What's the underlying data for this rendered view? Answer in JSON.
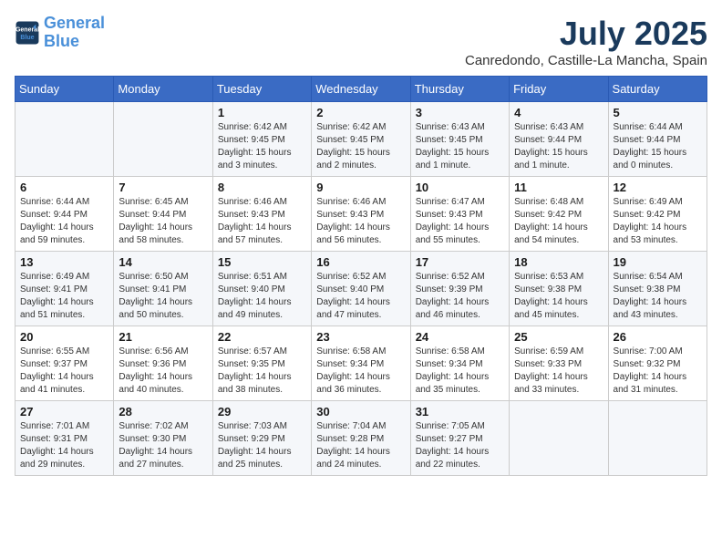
{
  "header": {
    "logo_line1": "General",
    "logo_line2": "Blue",
    "month": "July 2025",
    "location": "Canredondo, Castille-La Mancha, Spain"
  },
  "weekdays": [
    "Sunday",
    "Monday",
    "Tuesday",
    "Wednesday",
    "Thursday",
    "Friday",
    "Saturday"
  ],
  "weeks": [
    [
      {
        "day": "",
        "detail": ""
      },
      {
        "day": "",
        "detail": ""
      },
      {
        "day": "1",
        "detail": "Sunrise: 6:42 AM\nSunset: 9:45 PM\nDaylight: 15 hours\nand 3 minutes."
      },
      {
        "day": "2",
        "detail": "Sunrise: 6:42 AM\nSunset: 9:45 PM\nDaylight: 15 hours\nand 2 minutes."
      },
      {
        "day": "3",
        "detail": "Sunrise: 6:43 AM\nSunset: 9:45 PM\nDaylight: 15 hours\nand 1 minute."
      },
      {
        "day": "4",
        "detail": "Sunrise: 6:43 AM\nSunset: 9:44 PM\nDaylight: 15 hours\nand 1 minute."
      },
      {
        "day": "5",
        "detail": "Sunrise: 6:44 AM\nSunset: 9:44 PM\nDaylight: 15 hours\nand 0 minutes."
      }
    ],
    [
      {
        "day": "6",
        "detail": "Sunrise: 6:44 AM\nSunset: 9:44 PM\nDaylight: 14 hours\nand 59 minutes."
      },
      {
        "day": "7",
        "detail": "Sunrise: 6:45 AM\nSunset: 9:44 PM\nDaylight: 14 hours\nand 58 minutes."
      },
      {
        "day": "8",
        "detail": "Sunrise: 6:46 AM\nSunset: 9:43 PM\nDaylight: 14 hours\nand 57 minutes."
      },
      {
        "day": "9",
        "detail": "Sunrise: 6:46 AM\nSunset: 9:43 PM\nDaylight: 14 hours\nand 56 minutes."
      },
      {
        "day": "10",
        "detail": "Sunrise: 6:47 AM\nSunset: 9:43 PM\nDaylight: 14 hours\nand 55 minutes."
      },
      {
        "day": "11",
        "detail": "Sunrise: 6:48 AM\nSunset: 9:42 PM\nDaylight: 14 hours\nand 54 minutes."
      },
      {
        "day": "12",
        "detail": "Sunrise: 6:49 AM\nSunset: 9:42 PM\nDaylight: 14 hours\nand 53 minutes."
      }
    ],
    [
      {
        "day": "13",
        "detail": "Sunrise: 6:49 AM\nSunset: 9:41 PM\nDaylight: 14 hours\nand 51 minutes."
      },
      {
        "day": "14",
        "detail": "Sunrise: 6:50 AM\nSunset: 9:41 PM\nDaylight: 14 hours\nand 50 minutes."
      },
      {
        "day": "15",
        "detail": "Sunrise: 6:51 AM\nSunset: 9:40 PM\nDaylight: 14 hours\nand 49 minutes."
      },
      {
        "day": "16",
        "detail": "Sunrise: 6:52 AM\nSunset: 9:40 PM\nDaylight: 14 hours\nand 47 minutes."
      },
      {
        "day": "17",
        "detail": "Sunrise: 6:52 AM\nSunset: 9:39 PM\nDaylight: 14 hours\nand 46 minutes."
      },
      {
        "day": "18",
        "detail": "Sunrise: 6:53 AM\nSunset: 9:38 PM\nDaylight: 14 hours\nand 45 minutes."
      },
      {
        "day": "19",
        "detail": "Sunrise: 6:54 AM\nSunset: 9:38 PM\nDaylight: 14 hours\nand 43 minutes."
      }
    ],
    [
      {
        "day": "20",
        "detail": "Sunrise: 6:55 AM\nSunset: 9:37 PM\nDaylight: 14 hours\nand 41 minutes."
      },
      {
        "day": "21",
        "detail": "Sunrise: 6:56 AM\nSunset: 9:36 PM\nDaylight: 14 hours\nand 40 minutes."
      },
      {
        "day": "22",
        "detail": "Sunrise: 6:57 AM\nSunset: 9:35 PM\nDaylight: 14 hours\nand 38 minutes."
      },
      {
        "day": "23",
        "detail": "Sunrise: 6:58 AM\nSunset: 9:34 PM\nDaylight: 14 hours\nand 36 minutes."
      },
      {
        "day": "24",
        "detail": "Sunrise: 6:58 AM\nSunset: 9:34 PM\nDaylight: 14 hours\nand 35 minutes."
      },
      {
        "day": "25",
        "detail": "Sunrise: 6:59 AM\nSunset: 9:33 PM\nDaylight: 14 hours\nand 33 minutes."
      },
      {
        "day": "26",
        "detail": "Sunrise: 7:00 AM\nSunset: 9:32 PM\nDaylight: 14 hours\nand 31 minutes."
      }
    ],
    [
      {
        "day": "27",
        "detail": "Sunrise: 7:01 AM\nSunset: 9:31 PM\nDaylight: 14 hours\nand 29 minutes."
      },
      {
        "day": "28",
        "detail": "Sunrise: 7:02 AM\nSunset: 9:30 PM\nDaylight: 14 hours\nand 27 minutes."
      },
      {
        "day": "29",
        "detail": "Sunrise: 7:03 AM\nSunset: 9:29 PM\nDaylight: 14 hours\nand 25 minutes."
      },
      {
        "day": "30",
        "detail": "Sunrise: 7:04 AM\nSunset: 9:28 PM\nDaylight: 14 hours\nand 24 minutes."
      },
      {
        "day": "31",
        "detail": "Sunrise: 7:05 AM\nSunset: 9:27 PM\nDaylight: 14 hours\nand 22 minutes."
      },
      {
        "day": "",
        "detail": ""
      },
      {
        "day": "",
        "detail": ""
      }
    ]
  ]
}
